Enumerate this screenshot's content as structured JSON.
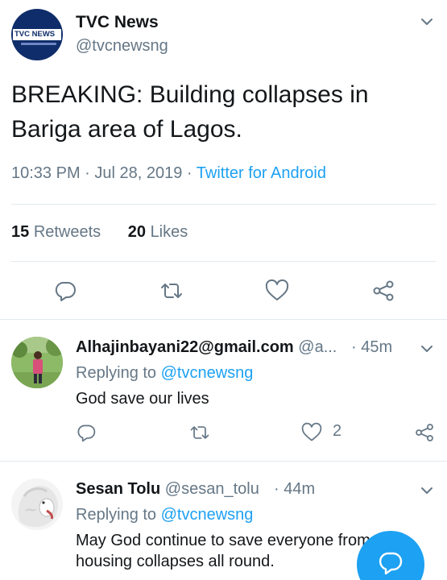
{
  "tweet": {
    "author_name": "TVC News",
    "author_handle": "@tvcnewsng",
    "avatar_logo": "TVC NEWS",
    "text": "BREAKING: Building collapses in Bariga area of Lagos.",
    "time": "10:33 PM",
    "date": "Jul 28, 2019",
    "separator": " · ",
    "source": "Twitter for Android",
    "retweets_count": "15",
    "retweets_label": "Retweets",
    "likes_count": "20",
    "likes_label": "Likes"
  },
  "replies": [
    {
      "name": "Alhajinbayani22@gmail.com",
      "handle": "@a...",
      "time": "· 45m",
      "replying_prefix": "Replying to ",
      "replying_to": "@tvcnewsng",
      "text": "God save our lives",
      "like_count": "2"
    },
    {
      "name": "Sesan Tolu",
      "handle": "@sesan_tolu",
      "time": "· 44m",
      "replying_prefix": "Replying to ",
      "replying_to": "@tvcnewsng",
      "text": "May God continue to save everyone from this housing collapses all round."
    }
  ],
  "icons": {
    "reply": "reply-icon",
    "retweet": "retweet-icon",
    "like": "heart-icon",
    "share": "share-icon",
    "more": "chevron-down-icon",
    "compose": "compose-reply-icon"
  },
  "colors": {
    "accent": "#1da1f2",
    "secondary_text": "#657786",
    "primary_text": "#14171a",
    "divider": "#e1e8ed"
  }
}
